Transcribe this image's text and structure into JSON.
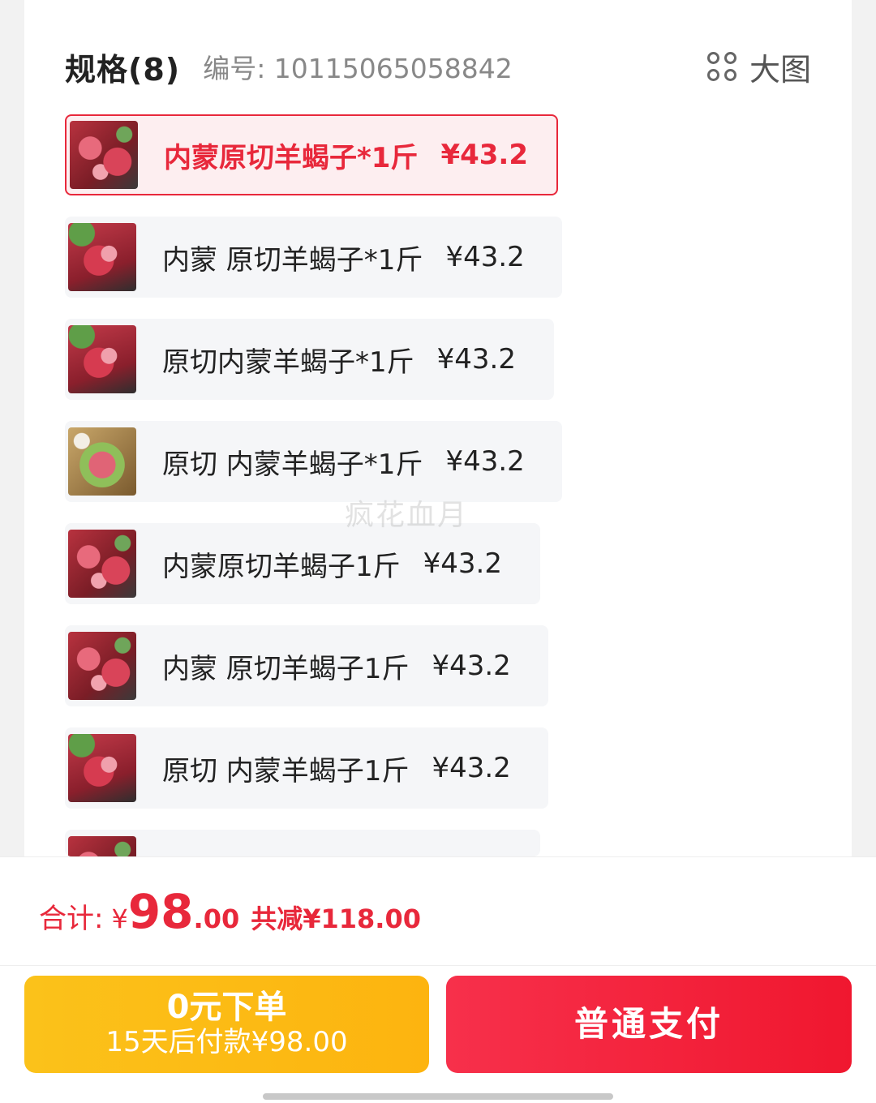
{
  "header": {
    "spec_title": "规格(8)",
    "code_label": "编号: 10115065058842",
    "big_view_label": "大图"
  },
  "options": [
    {
      "label": "内蒙原切羊蝎子*1斤",
      "price": "¥43.2",
      "selected": true
    },
    {
      "label": "内蒙 原切羊蝎子*1斤",
      "price": "¥43.2",
      "selected": false
    },
    {
      "label": "原切内蒙羊蝎子*1斤",
      "price": "¥43.2",
      "selected": false
    },
    {
      "label": "原切 内蒙羊蝎子*1斤",
      "price": "¥43.2",
      "selected": false
    },
    {
      "label": "内蒙原切羊蝎子1斤",
      "price": "¥43.2",
      "selected": false
    },
    {
      "label": "内蒙 原切羊蝎子1斤",
      "price": "¥43.2",
      "selected": false
    },
    {
      "label": "原切 内蒙羊蝎子1斤",
      "price": "¥43.2",
      "selected": false
    }
  ],
  "watermark": "疯花血月",
  "summary": {
    "total_label": "合计:",
    "currency": "¥",
    "total_integer": "98",
    "total_decimal": ".00",
    "saving": "共减¥118.00"
  },
  "buttons": {
    "zero_main": "0元下单",
    "zero_sub": "15天后付款¥98.00",
    "pay": "普通支付"
  },
  "colors": {
    "accent_red": "#e8283b",
    "yellow_button": "#fbc21a",
    "red_button": "#f0172f"
  }
}
